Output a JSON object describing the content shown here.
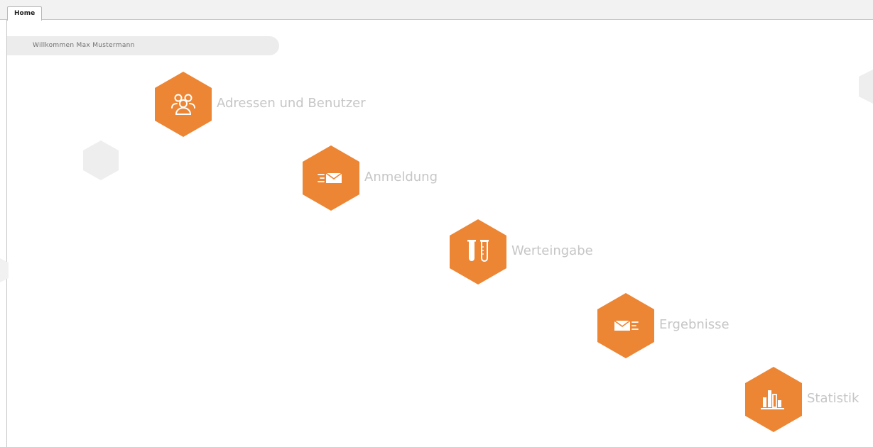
{
  "tabs": [
    {
      "label": "Home",
      "active": true
    }
  ],
  "welcome": {
    "text": "Willkommen Max Mustermann"
  },
  "colors": {
    "accent": "#EC8534",
    "label": "#C6C6C6",
    "decor_hex": "#EEEEEE"
  },
  "menu": {
    "items": [
      {
        "label": "Adressen und Benutzer",
        "icon": "users-icon"
      },
      {
        "label": "Anmeldung",
        "icon": "mail-send-icon"
      },
      {
        "label": "Werteingabe",
        "icon": "test-tubes-icon"
      },
      {
        "label": "Ergebnisse",
        "icon": "mail-receive-icon"
      },
      {
        "label": "Statistik",
        "icon": "bar-chart-icon"
      }
    ]
  }
}
